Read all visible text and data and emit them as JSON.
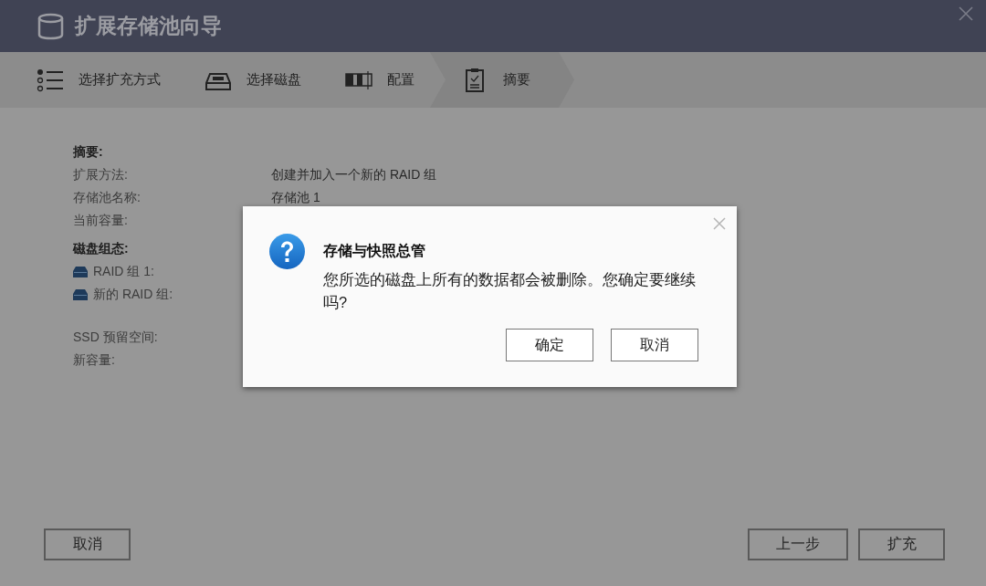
{
  "window": {
    "title": "扩展存储池向导"
  },
  "steps": [
    {
      "label": "选择扩充方式",
      "selected": false
    },
    {
      "label": "选择磁盘",
      "selected": false
    },
    {
      "label": "配置",
      "selected": false
    },
    {
      "label": "摘要",
      "selected": true
    }
  ],
  "summary": [
    {
      "kind": "heading",
      "label": "摘要:"
    },
    {
      "kind": "plain",
      "label": "扩展方法:",
      "value": "创建并加入一个新的 RAID 组"
    },
    {
      "kind": "plain",
      "label": "存储池名称:",
      "value": "存储池 1"
    },
    {
      "kind": "plain",
      "label": "当前容量:"
    },
    {
      "kind": "heading",
      "label": "磁盘组态:"
    },
    {
      "kind": "disk",
      "label": "RAID 组 1:"
    },
    {
      "kind": "disk",
      "label": "新的 RAID 组:"
    },
    {
      "kind": "spacer"
    },
    {
      "kind": "plain",
      "label": "SSD 预留空间:"
    },
    {
      "kind": "plain",
      "label": "新容量:"
    }
  ],
  "dialog": {
    "title": "存储与快照总管",
    "message": "您所选的磁盘上所有的数据都会被删除。您确定要继续吗?",
    "buttons": [
      "确定",
      "取消"
    ]
  },
  "footer": {
    "left_buttons": [
      "取消"
    ],
    "right_buttons": [
      "上一步",
      "扩充"
    ]
  }
}
